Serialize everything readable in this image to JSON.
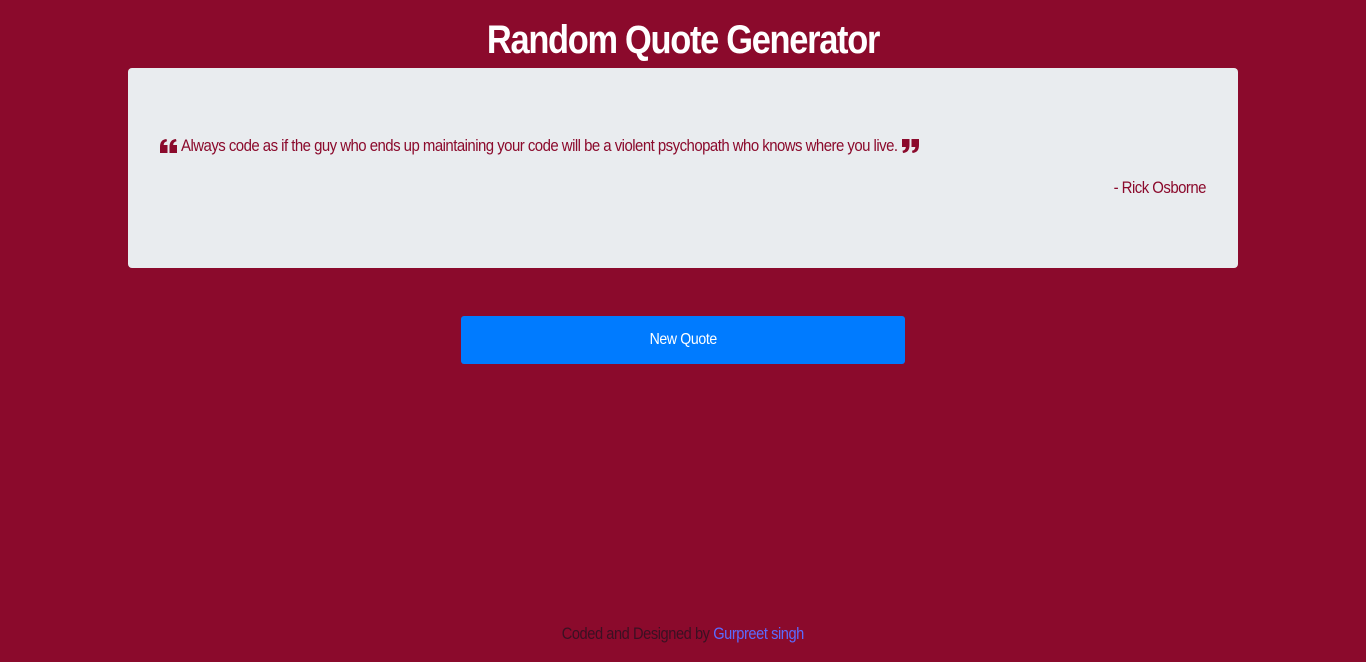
{
  "page": {
    "title": "Random Quote Generator"
  },
  "quote": {
    "text": "Always code as if the guy who ends up maintaining your code will be a violent psychopath who knows where you live.",
    "author": "- Rick Osborne",
    "open_icon": "quote-left-icon",
    "close_icon": "quote-right-icon"
  },
  "actions": {
    "new_quote_label": "New Quote"
  },
  "footer": {
    "text": "Coded and Designed by ",
    "link_text": "Gurpreet singh"
  },
  "colors": {
    "background": "#8B0A2C",
    "card": "#E9ECEF",
    "accent_button": "#007BFF",
    "link": "#5B6BFF"
  }
}
